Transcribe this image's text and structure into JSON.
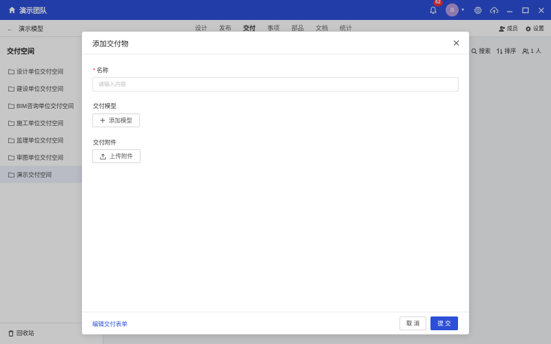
{
  "app": {
    "team_name": "演示团队",
    "notification_count": "62",
    "avatar_letter": "a"
  },
  "subheader": {
    "back_label": "演示模型",
    "tabs": [
      {
        "label": "设计",
        "active": false
      },
      {
        "label": "发布",
        "active": false
      },
      {
        "label": "交付",
        "active": true
      },
      {
        "label": "事项",
        "active": false
      },
      {
        "label": "部品",
        "active": false
      },
      {
        "label": "文档",
        "active": false
      },
      {
        "label": "统计",
        "active": false
      }
    ],
    "members_label": "成员",
    "settings_label": "设置"
  },
  "sidebar": {
    "title": "交付空间",
    "items": [
      {
        "label": "设计单位交付空间"
      },
      {
        "label": "建设单位交付空间"
      },
      {
        "label": "BIM咨询单位交付空间"
      },
      {
        "label": "施工单位交付空间"
      },
      {
        "label": "监理单位交付空间"
      },
      {
        "label": "审图单位交付空间"
      },
      {
        "label": "演示交付空间"
      }
    ],
    "recycle_label": "回收站"
  },
  "main": {
    "search_label": "搜索",
    "sort_label": "排序",
    "people_label": "1 人"
  },
  "modal": {
    "title": "添加交付物",
    "name_label": "名称",
    "name_placeholder": "请输入内容",
    "name_value": "",
    "model_label": "交付模型",
    "add_model_label": "添加模型",
    "attachment_label": "交付附件",
    "upload_label": "上传附件",
    "edit_form_link": "编辑交付表单",
    "cancel_label": "取 消",
    "submit_label": "提 交"
  },
  "colors": {
    "primary": "#2d4fd8",
    "badge": "#ee2f3b",
    "avatar": "#b79ae0"
  },
  "icons": [
    "home-icon",
    "bell-icon",
    "gear-icon",
    "cloud-upload-icon",
    "minimize-icon",
    "maximize-icon",
    "close-icon",
    "back-arrow-icon",
    "folder-icon",
    "trash-icon",
    "search-icon",
    "sort-icon",
    "user-icon",
    "plus-icon",
    "upload-icon"
  ]
}
